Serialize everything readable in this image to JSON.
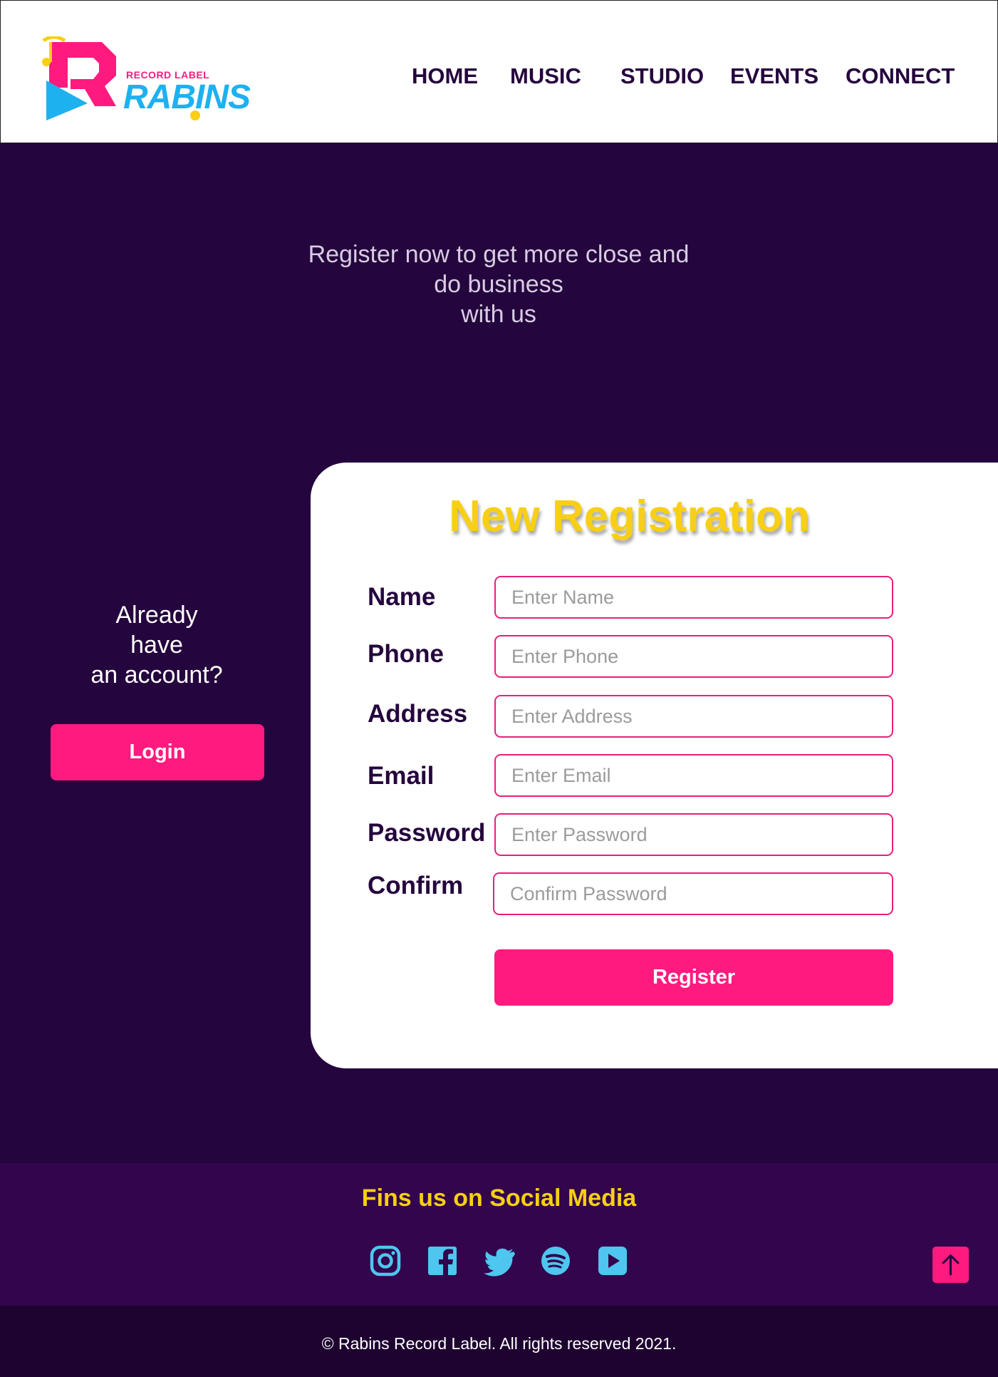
{
  "header": {
    "logo": {
      "sub": "RECORD LABEL",
      "main": "RABINS"
    },
    "nav": [
      "HOME",
      "MUSIC",
      "STUDIO",
      "EVENTS",
      "CONNECT"
    ]
  },
  "hero": {
    "lines": [
      "Register now to get more close  and",
      "do business",
      "with us"
    ]
  },
  "account": {
    "lines": [
      "Already",
      "have",
      "an account?"
    ],
    "login_label": "Login"
  },
  "form": {
    "title": "New Registration",
    "fields": [
      {
        "label": "Name",
        "placeholder": "Enter Name"
      },
      {
        "label": "Phone",
        "placeholder": "Enter Phone"
      },
      {
        "label": "Address",
        "placeholder": "Enter Address"
      },
      {
        "label": "Email",
        "placeholder": "Enter Email"
      },
      {
        "label": "Password",
        "placeholder": "Enter Password"
      },
      {
        "label": "Confirm",
        "placeholder": "Confirm Password"
      }
    ],
    "submit_label": "Register"
  },
  "social": {
    "title": "Fins us on Social Media",
    "icons": [
      "instagram-icon",
      "facebook-icon",
      "twitter-icon",
      "spotify-icon",
      "youtube-icon"
    ],
    "icon_color": "#4ec6ee"
  },
  "footer": {
    "copyright": "© Rabins Record Label. All rights reserved 2021."
  },
  "colors": {
    "background": "#25053d",
    "accent": "#ff1a7f",
    "title": "#f8cf14",
    "logo_blue": "#1eb1f0"
  }
}
